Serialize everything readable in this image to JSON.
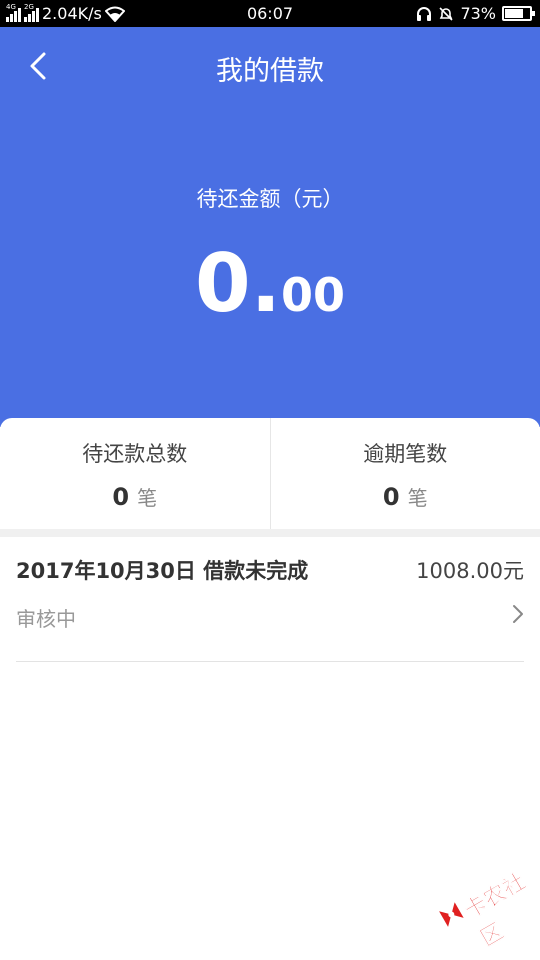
{
  "status_bar": {
    "network_speed": "2.04K/s",
    "time": "06:07",
    "battery": "73%",
    "battery_level": 0.73,
    "signal1_tag": "4G",
    "signal2_tag": "2G"
  },
  "header": {
    "title": "我的借款",
    "back_icon": "chevron-left-icon"
  },
  "summary": {
    "label": "待还金额（元）",
    "amount_int": "0",
    "amount_dot": ".",
    "amount_dec": "00"
  },
  "stats": [
    {
      "label": "待还款总数",
      "value": "0",
      "unit": "笔"
    },
    {
      "label": "逾期笔数",
      "value": "0",
      "unit": "笔"
    }
  ],
  "loans": [
    {
      "title": "2017年10月30日 借款未完成",
      "amount": "1008.00元",
      "status": "审核中"
    }
  ],
  "watermark": {
    "text": "卡农社区"
  },
  "colors": {
    "primary": "#4a6fe3",
    "watermark": "#e02020"
  }
}
